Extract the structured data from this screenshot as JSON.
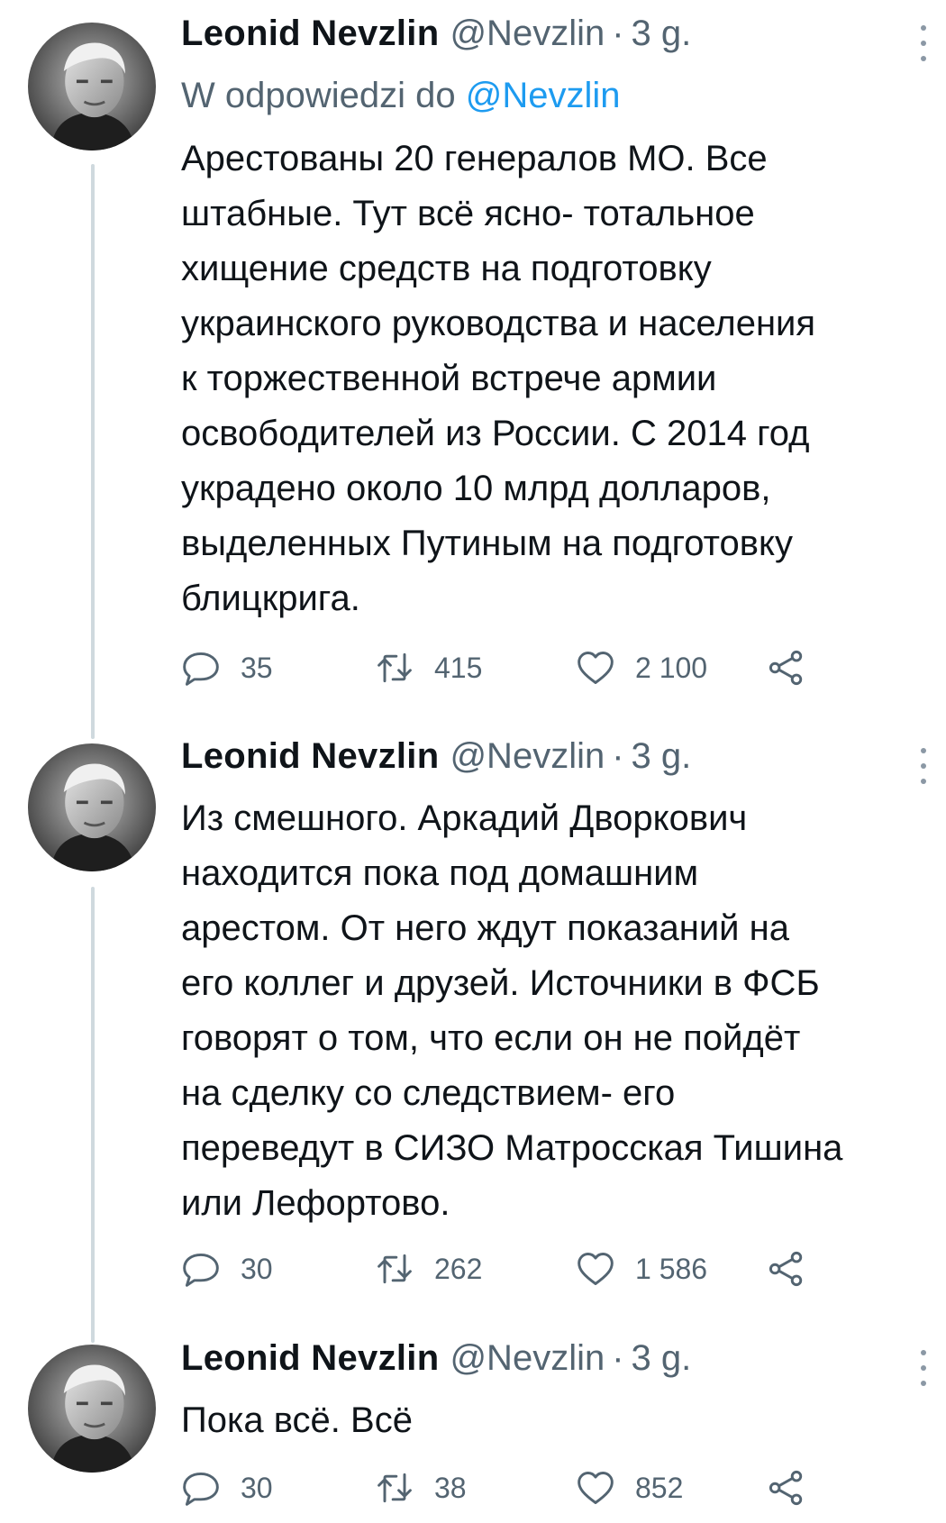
{
  "tweets": [
    {
      "author": "Leonid Nevzlin",
      "handle": "@Nevzlin",
      "separator": "·",
      "time": "3 g.",
      "reply_prefix": "W odpowiedzi do",
      "reply_mention": "@Nevzlin",
      "text": "Арестованы 20 генералов МО. Все\nштабные. Тут всё ясно- тотальное\nхищение средств на подготовку\nукраинского руководства и населения\nк торжественной встрече армии\nосвободителей из России. С 2014 год\nукрадено около 10 млрд долларов,\nвыделенных Путиным на подготовку\nблицкрига.",
      "replies": "35",
      "retweets": "415",
      "likes": "2 100"
    },
    {
      "author": "Leonid Nevzlin",
      "handle": "@Nevzlin",
      "separator": "·",
      "time": "3 g.",
      "text": "Из смешного. Аркадий Дворкович\nнаходится пока под домашним\nарестом. От него ждут показаний на\nего коллег и друзей. Источники в ФСБ\nговорят о том, что если он не пойдёт\nна сделку со следствием- его\nпереведут в СИЗО Матросская Тишина\nили Лефортово.",
      "replies": "30",
      "retweets": "262",
      "likes": "1 586"
    },
    {
      "author": "Leonid Nevzlin",
      "handle": "@Nevzlin",
      "separator": "·",
      "time": "3 g.",
      "text": "Пока всё. Всё",
      "replies": "30",
      "retweets": "38",
      "likes": "852"
    }
  ],
  "colors": {
    "text": "#0f1419",
    "secondary": "#536471",
    "accent": "#1d9bf0",
    "thread_line": "#cfd9de"
  },
  "icons": [
    "reply-icon",
    "retweet-icon",
    "like-icon",
    "share-icon",
    "more-icon"
  ]
}
